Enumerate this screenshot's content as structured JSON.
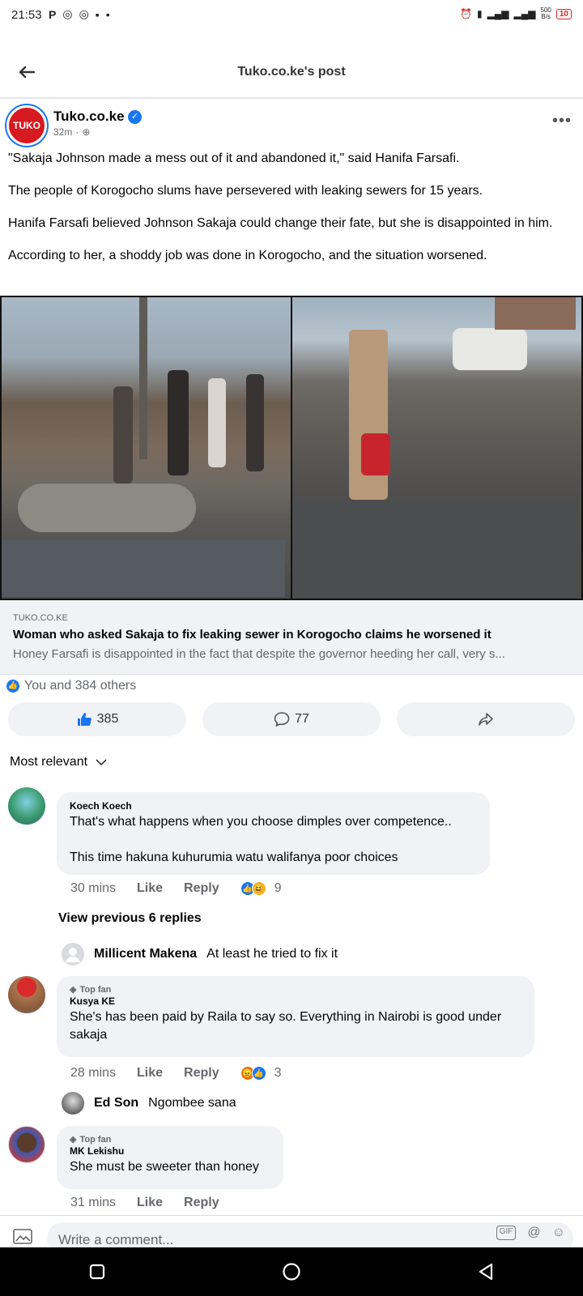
{
  "status_bar": {
    "time": "21:53",
    "speed_top": "500",
    "speed_unit": "B/s",
    "battery": "10"
  },
  "header": {
    "title": "Tuko.co.ke's post"
  },
  "post": {
    "avatar_text": "TUKO",
    "page_name": "Tuko.co.ke",
    "time": "32m",
    "paragraphs": [
      "\"Sakaja Johnson made a mess out of it and abandoned it,\" said Hanifa Farsafi.",
      "The people of Korogocho slums have persevered with leaking sewers for 15 years.",
      "Hanifa Farsafi believed Johnson Sakaja could change their fate, but she is disappointed in him.",
      "According to her, a shoddy job was done in Korogocho, and the situation worsened."
    ]
  },
  "link": {
    "domain": "TUKO.CO.KE",
    "title": "Woman who asked Sakaja to fix leaking sewer in Korogocho claims he worsened it",
    "description": "Honey Farsafi is disappointed in the fact that despite the governor heeding her call, very s..."
  },
  "reactions": {
    "summary": "You and 384 others",
    "likes": "385",
    "comments": "77"
  },
  "sort": {
    "label": "Most relevant"
  },
  "comments": [
    {
      "author": "Koech Koech",
      "text_line1": "That's what happens when you choose dimples over competence..",
      "text_line2": "This time hakuna kuhurumia watu walifanya poor choices",
      "time": "30 mins",
      "like": "Like",
      "reply": "Reply",
      "reaction_count": "9"
    },
    {
      "badge": "Top fan",
      "author": "Kusya KE",
      "text": "She's has been paid by Raila to say so. Everything in Nairobi is good under sakaja",
      "time": "28 mins",
      "like": "Like",
      "reply": "Reply",
      "reaction_count": "3"
    },
    {
      "badge": "Top fan",
      "author": "MK Lekishu",
      "text": "She must be sweeter than honey",
      "time": "31 mins",
      "like": "Like",
      "reply": "Reply"
    }
  ],
  "view_replies": "View previous 6 replies",
  "replies": [
    {
      "name": "Millicent Makena",
      "text": "At least he tried to fix it"
    },
    {
      "name": "Ed Son",
      "text": "Ngombee sana"
    }
  ],
  "composer": {
    "placeholder": "Write a comment..."
  },
  "colors": {
    "brand_blue": "#1877f2",
    "tuko_red": "#d71920",
    "bubble_bg": "#f0f2f5"
  }
}
